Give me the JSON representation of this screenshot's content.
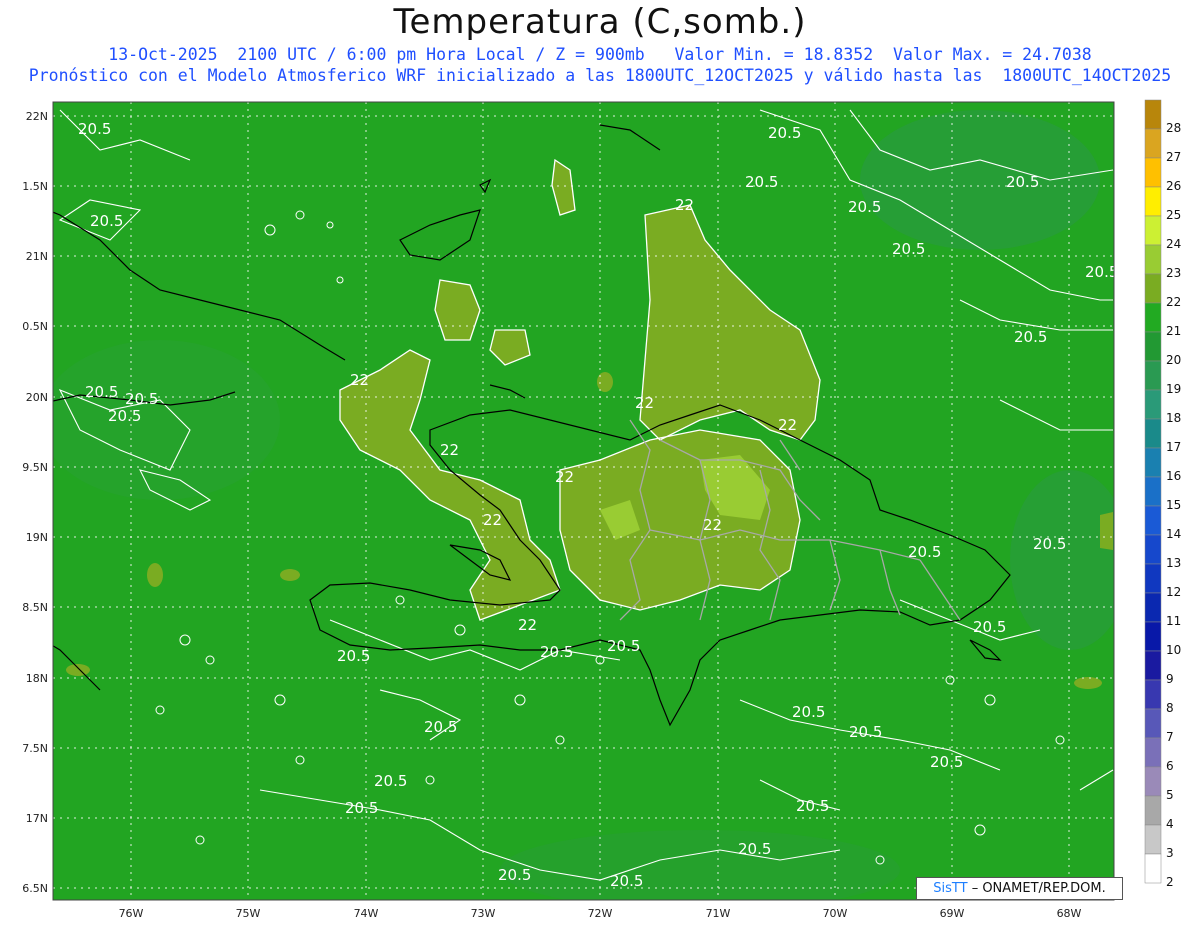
{
  "header": {
    "title": "Temperatura (C,somb.)",
    "subtitle_line1": "13-Oct-2025  2100 UTC / 6:00 pm Hora Local / Z = 900mb   Valor Min. = 18.8352  Valor Max. = 24.7038",
    "subtitle_line2": "Pronóstico con el Modelo Atmosferico WRF inicializado a las 1800UTC_12OCT2025 y válido hasta las  1800UTC_14OCT2025"
  },
  "axes": {
    "y_labels": [
      "22N",
      "1.5N",
      "21N",
      "0.5N",
      "20N",
      "9.5N",
      "19N",
      "8.5N",
      "18N",
      "7.5N",
      "17N",
      "6.5N"
    ],
    "x_labels": [
      "76W",
      "75W",
      "74W",
      "73W",
      "72W",
      "71W",
      "70W",
      "69W",
      "68W"
    ]
  },
  "colorbar": {
    "labels": [
      "28",
      "27",
      "26",
      "25",
      "24",
      "23",
      "22",
      "21",
      "20",
      "19",
      "18",
      "17",
      "16",
      "15",
      "14",
      "13",
      "12",
      "11",
      "10",
      "9",
      "8",
      "7",
      "6",
      "5",
      "4",
      "3",
      "2"
    ],
    "colors": [
      "#b8860b",
      "#daa520",
      "#ffc000",
      "#ffee00",
      "#ccf033",
      "#99cc33",
      "#7aac22",
      "#22aa22",
      "#229933",
      "#2a9a52",
      "#2a9a78",
      "#1a8a8a",
      "#1a80b0",
      "#1a70c8",
      "#1a5ad6",
      "#1648cc",
      "#1038c0",
      "#0a28b0",
      "#0818a8",
      "#1a1aa0",
      "#3838b0",
      "#5858b8",
      "#7a70b8",
      "#9a8ab8",
      "#a8a8a8",
      "#c8c8c8",
      "#ffffff"
    ]
  },
  "contour_labels": {
    "warm": "22",
    "mild": "20.5"
  },
  "credit": {
    "sis": "SisTT",
    "org": " – ONAMET/REP.DOM."
  },
  "colors": {
    "ocean_green": "#22a522",
    "land_warm": "#7aac22",
    "land_hot": "#99cc33",
    "cool_green": "#229933",
    "subtitle": "#1f4fff"
  }
}
